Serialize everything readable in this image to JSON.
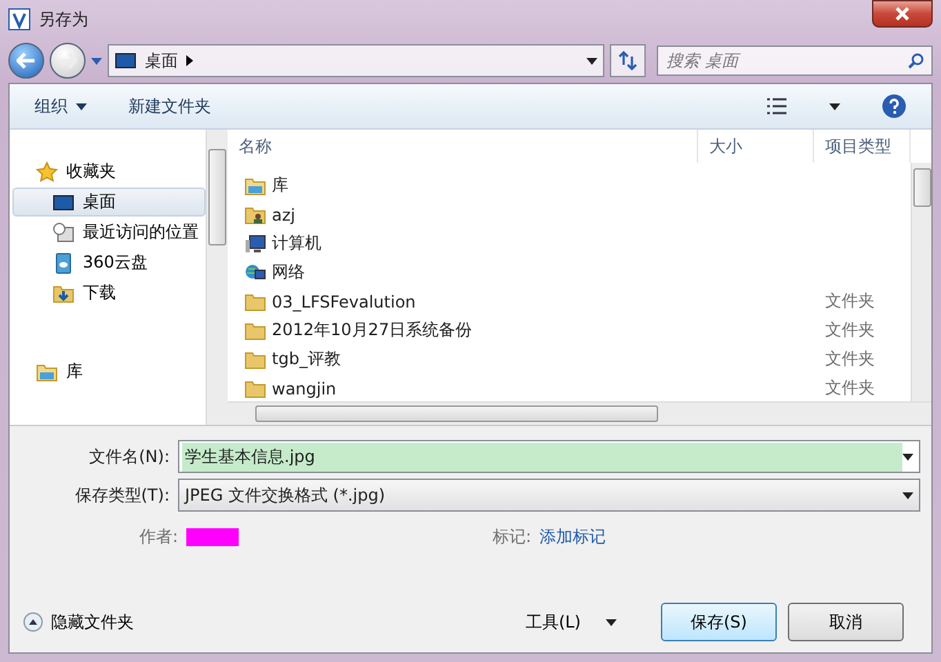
{
  "window": {
    "title": "另存为"
  },
  "address": {
    "location": "桌面"
  },
  "search": {
    "placeholder": "搜索 桌面"
  },
  "toolbar": {
    "organize": "组织",
    "new_folder": "新建文件夹"
  },
  "sidebar": {
    "items": [
      {
        "label": "收藏夹",
        "kind": "star",
        "selected": false,
        "children": [
          {
            "label": "桌面",
            "kind": "desktop",
            "selected": true
          },
          {
            "label": "最近访问的位置",
            "kind": "recent",
            "selected": false
          },
          {
            "label": "360云盘",
            "kind": "cloud",
            "selected": false
          },
          {
            "label": "下载",
            "kind": "download",
            "selected": false
          }
        ]
      },
      {
        "label": "库",
        "kind": "library",
        "selected": false
      }
    ]
  },
  "file_list": {
    "columns": [
      "名称",
      "大小",
      "项目类型"
    ],
    "rows": [
      {
        "name": "库",
        "kind": "library"
      },
      {
        "name": "azj",
        "kind": "user"
      },
      {
        "name": "计算机",
        "kind": "computer"
      },
      {
        "name": "网络",
        "kind": "network"
      },
      {
        "name": "03_LFSFevalution",
        "kind": "folder",
        "type": "文件夹"
      },
      {
        "name": "2012年10月27日系统备份",
        "kind": "folder",
        "type": "文件夹"
      },
      {
        "name": "tgb_评教",
        "kind": "folder",
        "type": "文件夹"
      },
      {
        "name": "wangjin",
        "kind": "folder",
        "type": "文件夹"
      }
    ]
  },
  "form": {
    "file_name_label": "文件名(N):",
    "file_name": "学生基本信息.jpg",
    "file_type_label": "保存类型(T):",
    "file_type": "JPEG 文件交换格式 (*.jpg)",
    "author_label": "作者:",
    "tags_label": "标记:",
    "tags_link": "添加标记"
  },
  "footer": {
    "hide_folders": "隐藏文件夹",
    "tools": "工具(L)",
    "buttons": [
      "保存(S)",
      "取消"
    ]
  }
}
